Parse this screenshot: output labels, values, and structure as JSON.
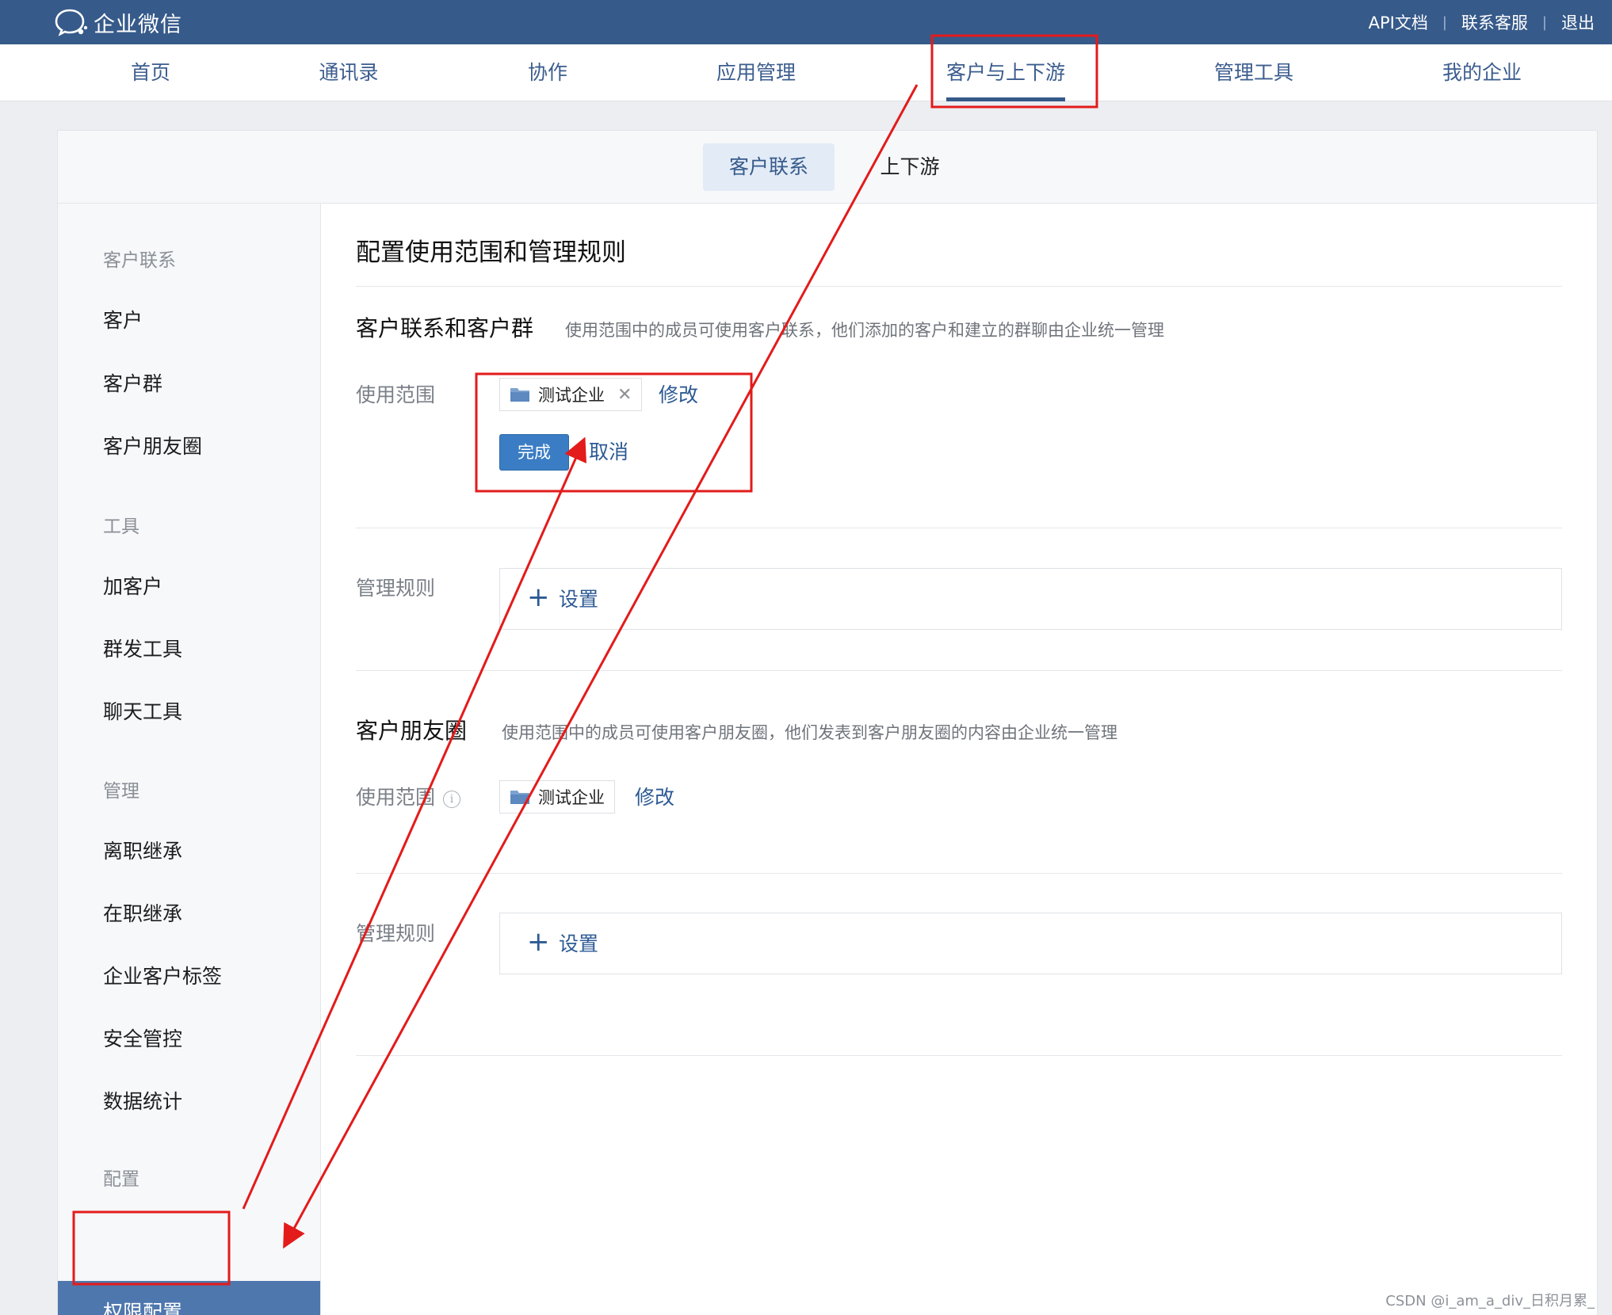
{
  "app": {
    "logo_text": "企业微信",
    "top_links": [
      "API文档",
      "联系客服",
      "退出"
    ]
  },
  "nav": {
    "items": [
      "首页",
      "通讯录",
      "协作",
      "应用管理",
      "客户与上下游",
      "管理工具",
      "我的企业"
    ],
    "active": "客户与上下游"
  },
  "subnav": {
    "tabs": [
      "客户联系",
      "上下游"
    ],
    "active": "客户联系"
  },
  "sidebar": {
    "groups": [
      {
        "title": "客户联系",
        "items": [
          "客户",
          "客户群",
          "客户朋友圈"
        ]
      },
      {
        "title": "工具",
        "items": [
          "加客户",
          "群发工具",
          "聊天工具"
        ]
      },
      {
        "title": "管理",
        "items": [
          "离职继承",
          "在职继承",
          "企业客户标签",
          "安全管控",
          "数据统计"
        ]
      },
      {
        "title": "配置",
        "items": [
          "权限配置"
        ]
      }
    ],
    "active": "权限配置"
  },
  "content": {
    "page_title": "配置使用范围和管理规则",
    "section1": {
      "title": "客户联系和客户群",
      "desc": "使用范围中的成员可使用客户联系，他们添加的客户和建立的群聊由企业统一管理",
      "scope_label": "使用范围",
      "scope_tag": "测试企业",
      "tag_close": "✕",
      "modify": "修改",
      "done": "完成",
      "cancel": "取消",
      "rule_label": "管理规则",
      "rule_plus": "+",
      "rule_action": "设置"
    },
    "section2": {
      "title": "客户朋友圈",
      "desc": "使用范围中的成员可使用客户朋友圈，他们发表到客户朋友圈的内容由企业统一管理",
      "scope_label": "使用范围",
      "info": "i",
      "scope_tag": "测试企业",
      "modify": "修改",
      "rule_label": "管理规则",
      "rule_plus": "+",
      "rule_action": "设置"
    }
  },
  "watermark": "CSDN @i_am_a_div_日积月累_",
  "colors": {
    "topbar": "#365a8a",
    "link": "#2d5a94",
    "primary_button": "#3b7dc4",
    "sidebar_active": "#4e77ae",
    "annotation": "#e31b1b"
  }
}
